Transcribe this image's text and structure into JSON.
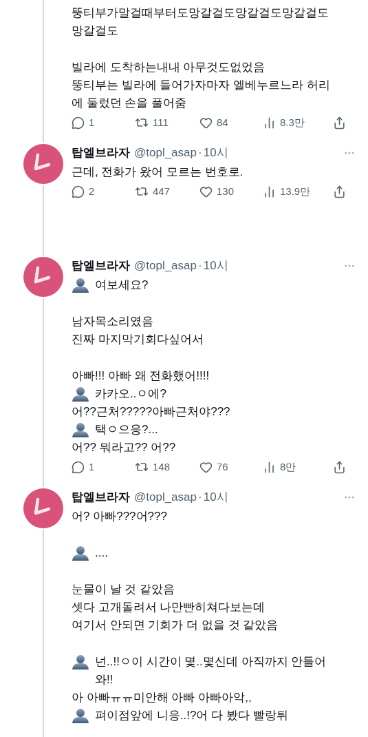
{
  "tweets": [
    {
      "paragraphs": [
        [
          {
            "text": "뚱티부가말걸때부터도망갈걸도망갈걸도망갈걸도",
            "speaker": false
          },
          {
            "text": "망갈걸도",
            "speaker": false
          }
        ],
        [
          {
            "text": "빌라에 도착하는내내 아무것도없었음",
            "speaker": false
          },
          {
            "text": "뚱티부는 빌라에 들어가자마자 엘베누르느라  허리에 둘렀던 손을 풀어줌",
            "speaker": false
          }
        ]
      ],
      "actions": {
        "replies": "1",
        "retweets": "111",
        "likes": "84",
        "views": "8.3만"
      }
    },
    {
      "author": {
        "name": "탑엘브라자",
        "handle": "@topl_asap",
        "separator": "·",
        "time": "10시"
      },
      "paragraphs": [
        [
          {
            "text": "근데, 전화가 왔어 모르는 번호로.",
            "speaker": false
          }
        ]
      ],
      "actions": {
        "replies": "2",
        "retweets": "447",
        "likes": "130",
        "views": "13.9만"
      }
    },
    {
      "author": {
        "name": "탑엘브라자",
        "handle": "@topl_asap",
        "separator": "·",
        "time": "10시"
      },
      "paragraphs": [
        [
          {
            "text": "여보세요?",
            "speaker": true
          }
        ],
        [
          {
            "text": "남자목소리였음",
            "speaker": false
          },
          {
            "text": "진짜 마지막기회다싶어서",
            "speaker": false
          }
        ],
        [
          {
            "text": "아빠!!! 아빠 왜 전화했어!!!!",
            "speaker": false
          },
          {
            "text": "카카오..ㅇ에?",
            "speaker": true
          },
          {
            "text": "어??근처?????아빠근처야???",
            "speaker": false
          },
          {
            "text": "택ㅇ으응?...",
            "speaker": true
          },
          {
            "text": "어?? 뭐라고?? 어??",
            "speaker": false
          }
        ]
      ],
      "actions": {
        "replies": "1",
        "retweets": "148",
        "likes": "76",
        "views": "8만"
      }
    },
    {
      "author": {
        "name": "탑엘브라자",
        "handle": "@topl_asap",
        "separator": "·",
        "time": "10시"
      },
      "paragraphs": [
        [
          {
            "text": "어? 아빠???어???",
            "speaker": false
          }
        ],
        [
          {
            "text": "....",
            "speaker": true
          }
        ],
        [
          {
            "text": "눈물이 날 것 같았음",
            "speaker": false
          },
          {
            "text": "셋다 고개돌려서 나만빤히쳐다보는데",
            "speaker": false
          },
          {
            "text": "여기서 안되면 기회가 더 없을 것 같았음",
            "speaker": false
          }
        ],
        [
          {
            "text": "넌..!!ㅇ이 시간이 몇..몇신데 아직까지 안들어와!!",
            "speaker": true
          },
          {
            "text": "아 아빠ㅠㅠ미안해 아빠 아빠아악,,",
            "speaker": false
          },
          {
            "text": "펴이점앞에 니응..!?어 다 봤다 빨랑튀",
            "speaker": true
          }
        ]
      ]
    }
  ]
}
